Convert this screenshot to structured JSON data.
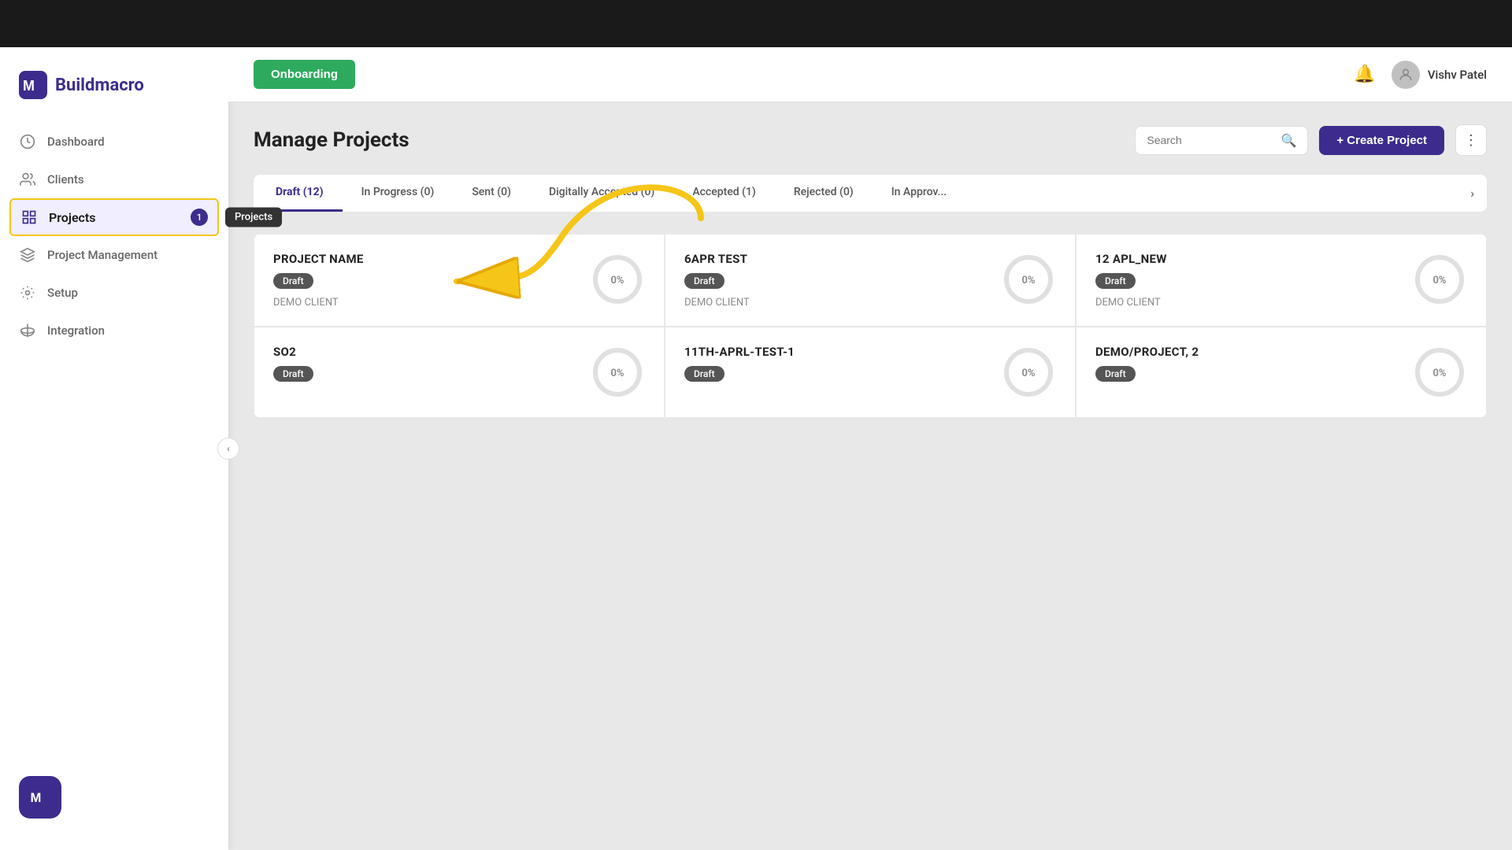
{
  "app": {
    "name": "Buildmacro",
    "logo_text": "Buildmacro"
  },
  "header": {
    "onboarding_label": "Onboarding",
    "notification_icon": "bell-icon",
    "user": {
      "name": "Vishv Patel",
      "avatar_icon": "user-icon"
    }
  },
  "sidebar": {
    "items": [
      {
        "id": "dashboard",
        "label": "Dashboard",
        "icon": "dashboard-icon",
        "active": false
      },
      {
        "id": "clients",
        "label": "Clients",
        "icon": "clients-icon",
        "active": false
      },
      {
        "id": "projects",
        "label": "Projects",
        "icon": "projects-icon",
        "active": true,
        "badge": "1"
      },
      {
        "id": "project-management",
        "label": "Project Management",
        "icon": "management-icon",
        "active": false
      },
      {
        "id": "setup",
        "label": "Setup",
        "icon": "setup-icon",
        "active": false
      },
      {
        "id": "integration",
        "label": "Integration",
        "icon": "integration-icon",
        "active": false
      }
    ],
    "tooltip": "Projects",
    "collapse_icon": "chevron-left-icon"
  },
  "projects_page": {
    "title": "Manage Projects",
    "search_placeholder": "Search",
    "create_button": "+ Create Project",
    "more_icon": "more-icon",
    "tabs": [
      {
        "id": "draft",
        "label": "Draft (12)",
        "active": true
      },
      {
        "id": "in-progress",
        "label": "In Progress (0)",
        "active": false
      },
      {
        "id": "sent",
        "label": "Sent (0)",
        "active": false
      },
      {
        "id": "digitally-accepted",
        "label": "Digitally Accepted (0)",
        "active": false
      },
      {
        "id": "accepted",
        "label": "Accepted (1)",
        "active": false
      },
      {
        "id": "rejected",
        "label": "Rejected (0)",
        "active": false
      },
      {
        "id": "in-approval",
        "label": "In Approv...",
        "active": false
      }
    ],
    "projects": [
      {
        "name": "PROJECT NAME",
        "status": "Draft",
        "client": "DEMO CLIENT",
        "progress": 0,
        "progress_label": "0%"
      },
      {
        "name": "6APR TEST",
        "status": "Draft",
        "client": "DEMO CLIENT",
        "progress": 0,
        "progress_label": "0%"
      },
      {
        "name": "12 APL_NEW",
        "status": "Draft",
        "client": "DEMO CLIENT",
        "progress": 0,
        "progress_label": "0%"
      },
      {
        "name": "SO2",
        "status": "Draft",
        "client": "",
        "progress": 0,
        "progress_label": "0%"
      },
      {
        "name": "11TH-APRL-TEST-1",
        "status": "Draft",
        "client": "",
        "progress": 0,
        "progress_label": "0%"
      },
      {
        "name": "DEMO/PROJECT, 2",
        "status": "Draft",
        "client": "",
        "progress": 0,
        "progress_label": "0%"
      }
    ]
  },
  "colors": {
    "primary": "#3d2c8d",
    "green": "#2eaa5e",
    "badge_bg": "#555555",
    "active_tab": "#3d2c8d"
  }
}
